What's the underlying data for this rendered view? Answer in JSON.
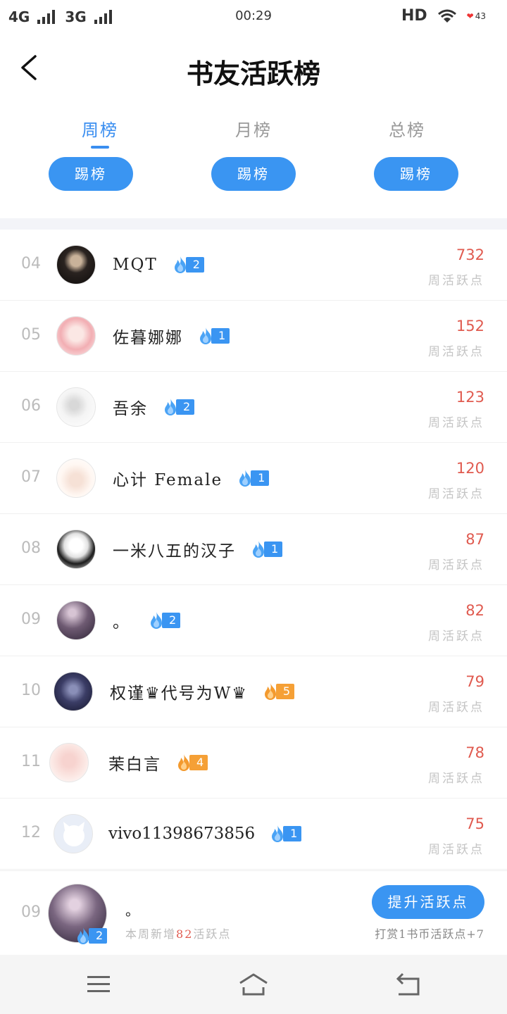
{
  "status_bar": {
    "net1": "4G",
    "net2": "3G",
    "time": "00:29",
    "hd": "HD",
    "battery": "43"
  },
  "header": {
    "title": "书友活跃榜"
  },
  "tabs": [
    {
      "label": "周榜",
      "active": true,
      "kick_label": "踢榜"
    },
    {
      "label": "月榜",
      "active": false,
      "kick_label": "踢榜"
    },
    {
      "label": "总榜",
      "active": false,
      "kick_label": "踢榜"
    }
  ],
  "score_label": "周活跃点",
  "rows": [
    {
      "rank": "04",
      "name": "MQT",
      "level": "2",
      "badge_color": "blue",
      "score": "732"
    },
    {
      "rank": "05",
      "name": "佐暮娜娜",
      "level": "1",
      "badge_color": "blue",
      "score": "152"
    },
    {
      "rank": "06",
      "name": "吾余",
      "level": "2",
      "badge_color": "blue",
      "score": "123"
    },
    {
      "rank": "07",
      "name": "心计 Female",
      "level": "1",
      "badge_color": "blue",
      "score": "120"
    },
    {
      "rank": "08",
      "name": "一米八五的汉子",
      "level": "1",
      "badge_color": "blue",
      "score": "87"
    },
    {
      "rank": "09",
      "name": "。",
      "level": "2",
      "badge_color": "blue",
      "score": "82"
    },
    {
      "rank": "10",
      "name": "权谨♛代号为W♛",
      "level": "5",
      "badge_color": "orange",
      "score": "79"
    },
    {
      "rank": "11",
      "name": "茉白言",
      "level": "4",
      "badge_color": "orange",
      "score": "78"
    },
    {
      "rank": "12",
      "name": "vivo11398673856",
      "level": "1",
      "badge_color": "blue",
      "score": "75"
    }
  ],
  "me": {
    "rank": "09",
    "name": "。",
    "level": "2",
    "sub_prefix": "本周新增",
    "sub_points": "82",
    "sub_suffix": "活跃点",
    "boost_label": "提升活跃点",
    "reward_text": "打赏1书币活跃点+7"
  },
  "colors": {
    "accent": "#3a95f2",
    "score": "#e05a4f",
    "orange_badge": "#f5a036"
  }
}
